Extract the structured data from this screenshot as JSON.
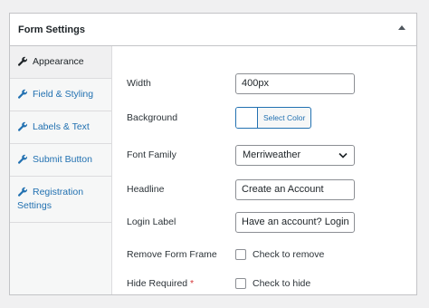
{
  "panel": {
    "title": "Form Settings",
    "collapse_icon": "triangle-up-icon"
  },
  "sidebar": {
    "items": [
      {
        "label": "Appearance",
        "icon": "wrench-icon",
        "active": true
      },
      {
        "label": "Field & Styling",
        "icon": "wrench-icon",
        "active": false
      },
      {
        "label": "Labels & Text",
        "icon": "wrench-icon",
        "active": false
      },
      {
        "label": "Submit Button",
        "icon": "wrench-icon",
        "active": false
      },
      {
        "label_line1": "Registration",
        "label_line2": "Settings",
        "icon": "wrench-icon",
        "active": false
      }
    ]
  },
  "fields": {
    "width": {
      "label": "Width",
      "value": "400px"
    },
    "background": {
      "label": "Background",
      "button_label": "Select Color",
      "swatch_color": "#ffffff"
    },
    "font_family": {
      "label": "Font Family",
      "selected": "Merriweather"
    },
    "headline": {
      "label": "Headline",
      "value": "Create an Account"
    },
    "login_label": {
      "label": "Login Label",
      "value": "Have an account? Login"
    },
    "remove_frame": {
      "label": "Remove Form Frame",
      "checkbox_label": "Check to remove",
      "checked": false
    },
    "hide_required": {
      "label": "Hide Required",
      "required_mark": "*",
      "checkbox_label": "Check to hide",
      "checked": false
    }
  },
  "colors": {
    "accent": "#2271b1",
    "required": "#d63638",
    "border": "#c3c4c7"
  }
}
